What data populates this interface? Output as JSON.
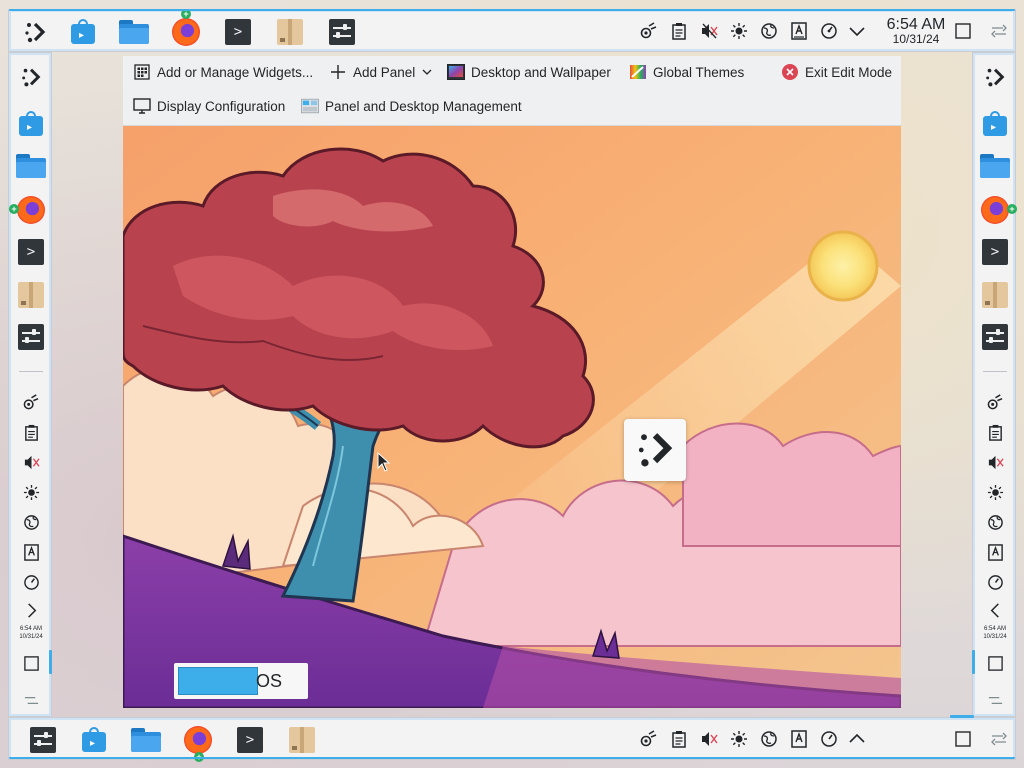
{
  "toolbar": {
    "add_widgets": "Add or Manage Widgets...",
    "add_panel": "Add Panel",
    "desktop_wallpaper": "Desktop and Wallpaper",
    "global_themes": "Global Themes",
    "exit_edit_mode": "Exit Edit Mode",
    "display_configuration": "Display Configuration",
    "panel_desktop_management": "Panel and Desktop Management"
  },
  "clock": {
    "time": "6:54 AM",
    "date": "10/31/24"
  },
  "os_badge": {
    "text": "OS"
  },
  "tray_icons": [
    "kdeconnect-icon",
    "clipboard-icon",
    "volume-muted-icon",
    "brightness-icon",
    "network-icon",
    "keyboard-layout-icon",
    "power-profile-icon",
    "expand-arrow-icon"
  ],
  "taskbar_apps": [
    "kde-application-launcher",
    "discover-store",
    "dolphin-file-manager",
    "firefox",
    "konsole-terminal",
    "ark-archiver",
    "system-settings"
  ],
  "colors": {
    "panel_bg": "#f3f3f4",
    "accent": "#3daee9",
    "exit_red": "#da4453"
  }
}
